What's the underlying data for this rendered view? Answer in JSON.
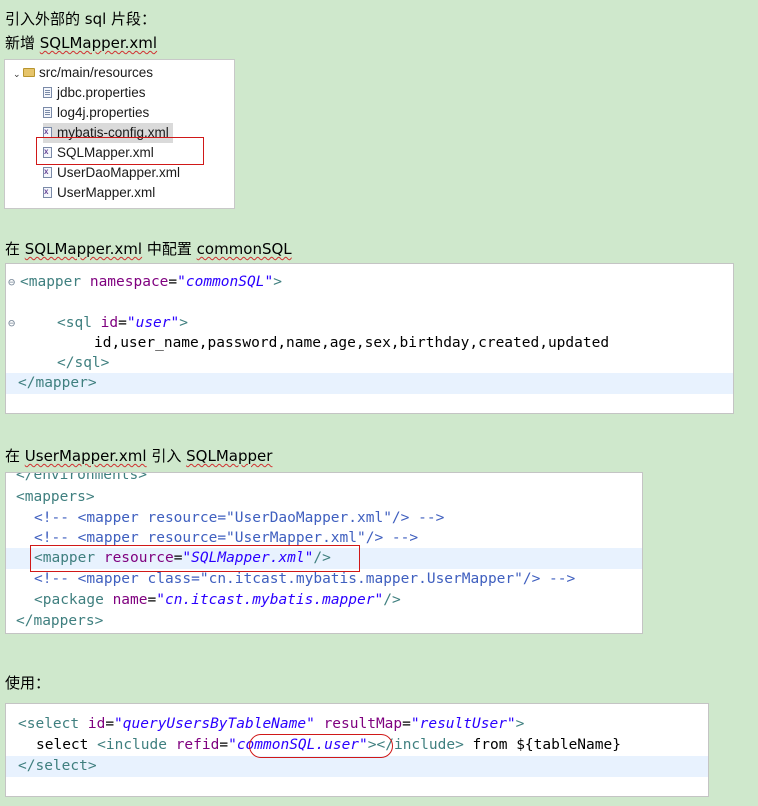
{
  "heading1": "引入外部的 sql 片段：",
  "heading2_prefix": "新增 ",
  "heading2_file": "SQLMapper.xml",
  "tree": {
    "folder": "src/main/resources",
    "files": [
      {
        "name": "jdbc.properties",
        "type": "properties"
      },
      {
        "name": "log4j.properties",
        "type": "properties"
      },
      {
        "name": "mybatis-config.xml",
        "type": "xml"
      },
      {
        "name": "SQLMapper.xml",
        "type": "xml"
      },
      {
        "name": "UserDaoMapper.xml",
        "type": "xml"
      },
      {
        "name": "UserMapper.xml",
        "type": "xml"
      }
    ]
  },
  "heading3": {
    "a": "在 ",
    "b": "SQLMapper.xml",
    "c": " 中配置 ",
    "d": "commonSQL"
  },
  "code1": {
    "l1": {
      "open": "<mapper",
      "attr": "namespace",
      "eq": "=",
      "val": "\"commonSQL\"",
      "close": ">"
    },
    "l3": {
      "open": "<sql",
      "attr": "id",
      "eq": "=",
      "val": "\"user\"",
      "close": ">"
    },
    "l4": "id,user_name,password,name,age,sex,birthday,created,updated",
    "l5": "</sql>",
    "l6": "</mapper>"
  },
  "heading4": {
    "a": "在 ",
    "b": "UserMapper.xml",
    "c": " 引入 ",
    "d": "SQLMapper"
  },
  "code2": {
    "l0": "</environments>",
    "l1": "<mappers>",
    "l2": "<!-- <mapper resource=\"UserDaoMapper.xml\"/> -->",
    "l3": "<!-- <mapper resource=\"UserMapper.xml\"/> -->",
    "l4": {
      "open": "<mapper",
      "attr": "resource",
      "eq": "=",
      "val": "\"SQLMapper.xml\"",
      "close": "/>"
    },
    "l5": "<!-- <mapper class=\"cn.itcast.mybatis.mapper.UserMapper\"/> -->",
    "l6": {
      "open": "<package",
      "attr": "name",
      "eq": "=",
      "val": "\"cn.itcast.mybatis.mapper\"",
      "close": "/>"
    },
    "l7": "</mappers>"
  },
  "heading5": "使用：",
  "code3": {
    "l1": {
      "open": "<select",
      "attr1": "id",
      "val1": "\"queryUsersByTableName\"",
      "attr2": "resultMap",
      "val2": "\"resultUser\"",
      "close": ">"
    },
    "l2": {
      "kw": "select",
      "inc": "<include",
      "attr": "refid",
      "eq": "=",
      "val": "\"commonSQL.user\"",
      "endinc": "></include>",
      "rest": " from ${tableName}"
    },
    "l3": "</select>"
  }
}
